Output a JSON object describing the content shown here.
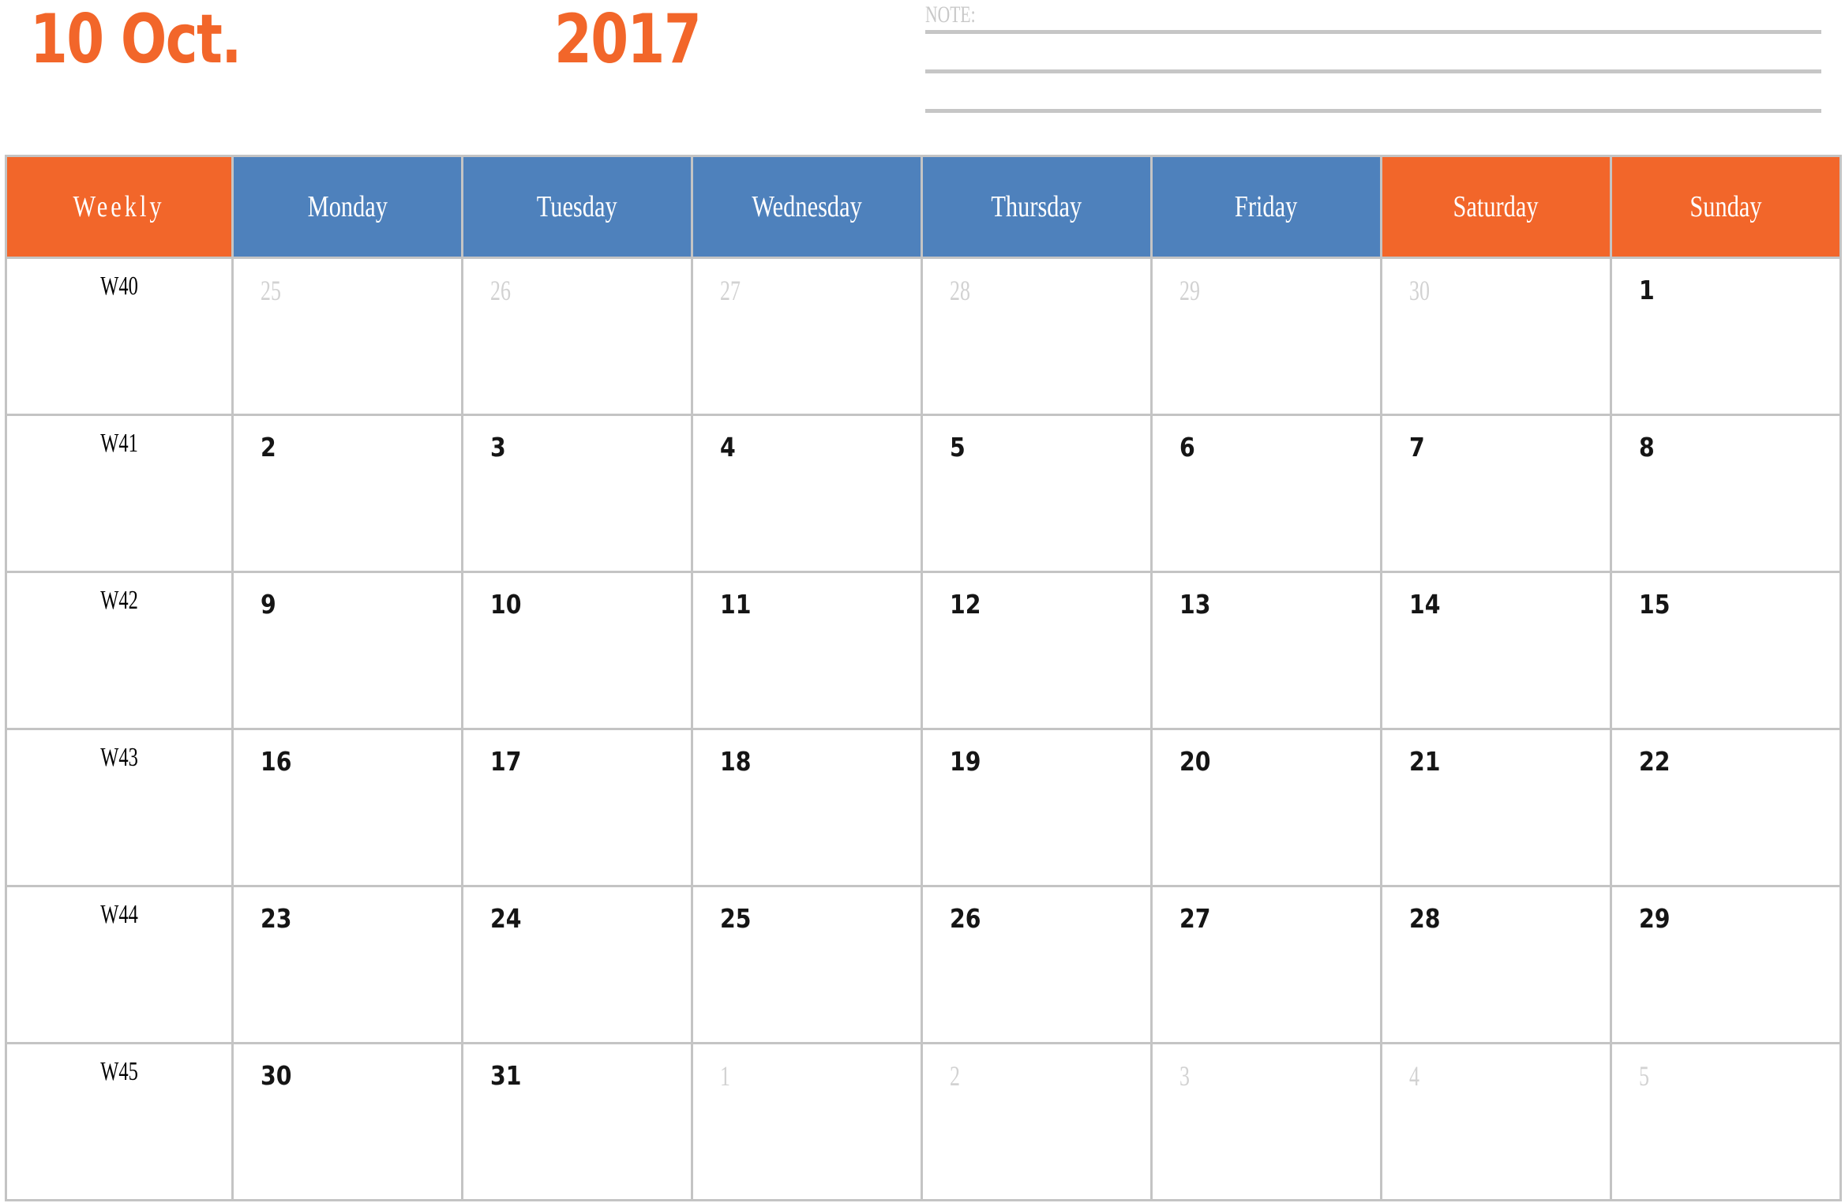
{
  "header": {
    "month_label": "10 Oct.",
    "year_label": "2017",
    "accent_orange": "#F2662A",
    "accent_blue": "#4E81BC",
    "grid_color": "#C4C4C4"
  },
  "note": {
    "label": "NOTE:",
    "line_count": 3,
    "line_color": "#C6C6C6"
  },
  "table": {
    "columns": [
      {
        "label": "Weekly",
        "type": "week"
      },
      {
        "label": "Monday",
        "type": "weekday"
      },
      {
        "label": "Tuesday",
        "type": "weekday"
      },
      {
        "label": "Wednesday",
        "type": "weekday"
      },
      {
        "label": "Thursday",
        "type": "weekday"
      },
      {
        "label": "Friday",
        "type": "weekday"
      },
      {
        "label": "Saturday",
        "type": "weekend"
      },
      {
        "label": "Sunday",
        "type": "weekend"
      }
    ],
    "rows": [
      {
        "week": "W40",
        "days": [
          {
            "num": "25",
            "in_month": false
          },
          {
            "num": "26",
            "in_month": false
          },
          {
            "num": "27",
            "in_month": false
          },
          {
            "num": "28",
            "in_month": false
          },
          {
            "num": "29",
            "in_month": false
          },
          {
            "num": "30",
            "in_month": false
          },
          {
            "num": "1",
            "in_month": true
          }
        ]
      },
      {
        "week": "W41",
        "days": [
          {
            "num": "2",
            "in_month": true
          },
          {
            "num": "3",
            "in_month": true
          },
          {
            "num": "4",
            "in_month": true
          },
          {
            "num": "5",
            "in_month": true
          },
          {
            "num": "6",
            "in_month": true
          },
          {
            "num": "7",
            "in_month": true
          },
          {
            "num": "8",
            "in_month": true
          }
        ]
      },
      {
        "week": "W42",
        "days": [
          {
            "num": "9",
            "in_month": true
          },
          {
            "num": "10",
            "in_month": true
          },
          {
            "num": "11",
            "in_month": true
          },
          {
            "num": "12",
            "in_month": true
          },
          {
            "num": "13",
            "in_month": true
          },
          {
            "num": "14",
            "in_month": true
          },
          {
            "num": "15",
            "in_month": true
          }
        ]
      },
      {
        "week": "W43",
        "days": [
          {
            "num": "16",
            "in_month": true
          },
          {
            "num": "17",
            "in_month": true
          },
          {
            "num": "18",
            "in_month": true
          },
          {
            "num": "19",
            "in_month": true
          },
          {
            "num": "20",
            "in_month": true
          },
          {
            "num": "21",
            "in_month": true
          },
          {
            "num": "22",
            "in_month": true
          }
        ]
      },
      {
        "week": "W44",
        "days": [
          {
            "num": "23",
            "in_month": true
          },
          {
            "num": "24",
            "in_month": true
          },
          {
            "num": "25",
            "in_month": true
          },
          {
            "num": "26",
            "in_month": true
          },
          {
            "num": "27",
            "in_month": true
          },
          {
            "num": "28",
            "in_month": true
          },
          {
            "num": "29",
            "in_month": true
          }
        ]
      },
      {
        "week": "W45",
        "days": [
          {
            "num": "30",
            "in_month": true
          },
          {
            "num": "31",
            "in_month": true
          },
          {
            "num": "1",
            "in_month": false
          },
          {
            "num": "2",
            "in_month": false
          },
          {
            "num": "3",
            "in_month": false
          },
          {
            "num": "4",
            "in_month": false
          },
          {
            "num": "5",
            "in_month": false
          }
        ]
      }
    ]
  }
}
